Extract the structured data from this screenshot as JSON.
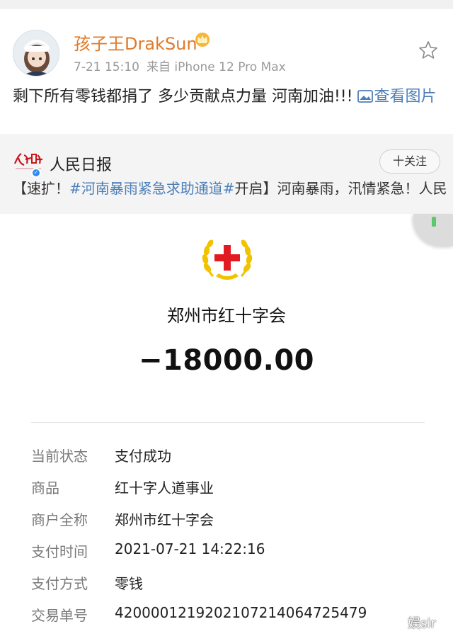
{
  "post": {
    "username": "孩子王DrakSun",
    "time": "7-21 15:10",
    "source": "来自 iPhone 12 Pro Max",
    "text": "剩下所有零钱都捐了 多少贡献点力量 河南加油!!! ",
    "view_image_label": "查看图片"
  },
  "repost": {
    "account_name": "人民日报",
    "follow_label": "十关注",
    "text_prefix": "【速扩！",
    "tag": "#河南暴雨紧急求助通道#",
    "text_suffix": "开启】河南暴雨，汛情紧急！人民日报新媒体开通“河南暴雨紧急求助通道”，如果您"
  },
  "receipt": {
    "merchant": "郑州市红十字会",
    "amount": "−18000.00",
    "details": [
      {
        "label": "当前状态",
        "value": "支付成功"
      },
      {
        "label": "商品",
        "value": "红十字人道事业"
      },
      {
        "label": "商户全称",
        "value": "郑州市红十字会"
      },
      {
        "label": "支付时间",
        "value": "2021-07-21 14:22:16"
      },
      {
        "label": "支付方式",
        "value": "零钱"
      },
      {
        "label": "交易单号",
        "value": "4200001219202107214064725479"
      }
    ]
  },
  "watermark": "娱sir",
  "colors": {
    "username": "#e07a2a",
    "link": "#4d7fb8",
    "red_cross": "#e21b23",
    "emblem_gold": "#f2c200"
  },
  "icons": [
    "crown-icon",
    "star-icon",
    "image-icon",
    "verified-icon",
    "red-cross-emblem-icon"
  ]
}
